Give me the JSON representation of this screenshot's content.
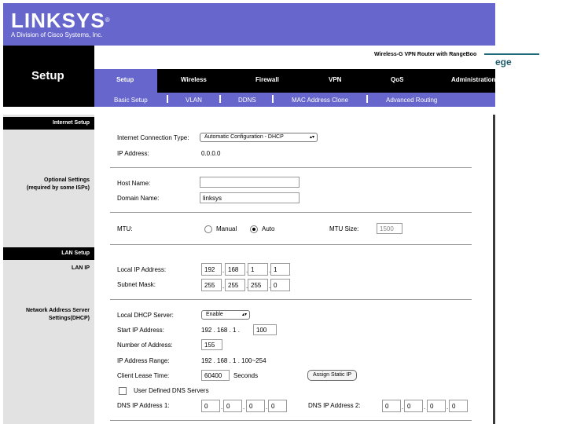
{
  "brand": {
    "logo": "LINKSYS",
    "registered": "®",
    "tagline": "A Division of Cisco Systems, Inc.",
    "product": "Wireless-G VPN Router with RangeBoo",
    "overlap_text": "ege"
  },
  "page_title": "Setup",
  "tabs": [
    {
      "label": "Setup"
    },
    {
      "label": "Wireless"
    },
    {
      "label": "Firewall"
    },
    {
      "label": "VPN"
    },
    {
      "label": "QoS"
    },
    {
      "label": "Administration"
    }
  ],
  "subtabs": [
    {
      "label": "Basic Setup"
    },
    {
      "label": "VLAN"
    },
    {
      "label": "DDNS"
    },
    {
      "label": "MAC Address Clone"
    },
    {
      "label": "Advanced Routing"
    }
  ],
  "sections": {
    "internet_setup": "Internet Setup",
    "optional_settings": "Optional Settings",
    "optional_settings_sub": "(required by some ISPs)",
    "lan_setup": "LAN Setup",
    "lan_ip": "LAN IP",
    "dhcp": "Network Address Server",
    "dhcp_sub": "Settings(DHCP)"
  },
  "internet": {
    "connection_type_label": "Internet Connection Type:",
    "connection_type_value": "Automatic Configuration - DHCP",
    "ip_label": "IP Address:",
    "ip_value": "0.0.0.0"
  },
  "optional": {
    "host_label": "Host Name:",
    "host_value": "",
    "domain_label": "Domain Name:",
    "domain_value": "linksys",
    "mtu_label": "MTU:",
    "mtu_manual": "Manual",
    "mtu_auto": "Auto",
    "mtu_selected": "Auto",
    "mtu_size_label": "MTU Size:",
    "mtu_size_value": "1500"
  },
  "lan": {
    "local_ip_label": "Local IP Address:",
    "local_ip": [
      "192",
      "168",
      "1",
      "1"
    ],
    "subnet_label": "Subnet Mask:",
    "subnet": [
      "255",
      "255",
      "255",
      "0"
    ]
  },
  "dhcp": {
    "server_label": "Local DHCP Server:",
    "server_value": "Enable",
    "start_label": "Start IP Address:",
    "start_prefix": "192 . 168 . 1 .",
    "start_value": "100",
    "number_label": "Number of Address:",
    "number_value": "155",
    "range_label": "IP Address Range:",
    "range_value": "192 . 168 . 1 . 100~254",
    "lease_label": "Client Lease Time:",
    "lease_value": "60400",
    "lease_unit": "Seconds",
    "static_button": "Assign Static IP",
    "user_dns_label": "User Defined DNS Servers",
    "dns1_label": "DNS IP Address 1:",
    "dns1": [
      "0",
      "0",
      "0",
      "0"
    ],
    "dns2_label": "DNS IP Address 2:",
    "dns2": [
      "0",
      "0",
      "0",
      "0"
    ]
  },
  "colors": {
    "header": "#6666cc",
    "dark": "#000000",
    "panel": "#e2e2e2"
  }
}
